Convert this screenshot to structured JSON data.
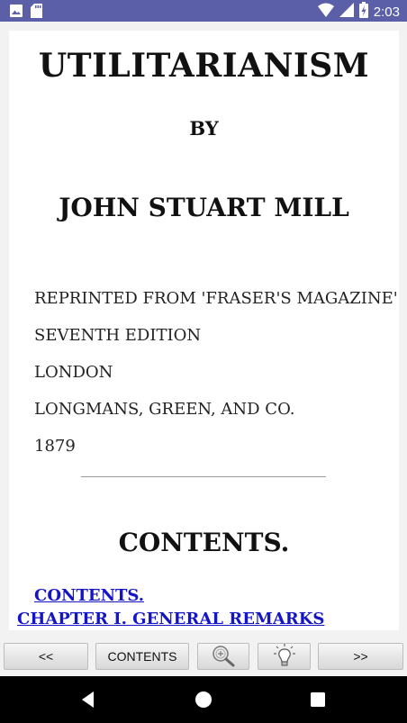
{
  "status_bar": {
    "time": "2:03",
    "icons": [
      "photo-icon",
      "sd-card-icon",
      "wifi-icon",
      "signal-icon",
      "battery-charging-icon"
    ]
  },
  "book": {
    "title": "UTILITARIANISM",
    "by": "BY",
    "author": "JOHN STUART MILL",
    "publication_lines": [
      "REPRINTED FROM 'FRASER'S MAGAZINE'",
      "SEVENTH EDITION",
      "LONDON",
      "LONGMANS, GREEN, AND CO.",
      "1879"
    ],
    "contents_heading": "CONTENTS.",
    "toc_links": [
      "CONTENTS.",
      "CHAPTER I. GENERAL REMARKS"
    ]
  },
  "toolbar": {
    "prev_label": "<<",
    "contents_label": "CONTENTS",
    "zoom_icon": "zoom-icon",
    "light_icon": "lightbulb-icon",
    "next_label": ">>"
  },
  "navbar": {
    "buttons": [
      "back-icon",
      "home-icon",
      "recent-apps-icon"
    ]
  }
}
